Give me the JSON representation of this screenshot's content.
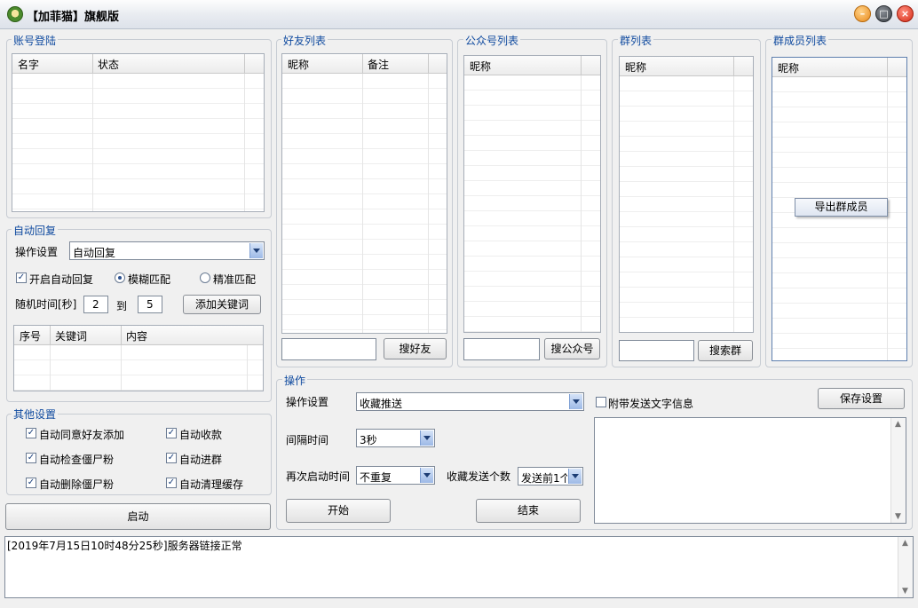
{
  "window": {
    "title": "【加菲猫】旗舰版",
    "controls": {
      "minimize": "minimize-icon",
      "maximize": "maximize-icon",
      "close": "close-icon"
    }
  },
  "account_login": {
    "legend": "账号登陆",
    "columns": [
      "名字",
      "状态"
    ]
  },
  "auto_reply": {
    "legend": "自动回复",
    "op_label": "操作设置",
    "op_value": "自动回复",
    "enable_label": "开启自动回复",
    "fuzzy_label": "模糊匹配",
    "exact_label": "精准匹配",
    "random_label": "随机时间[秒]",
    "random_from": "2",
    "to_label": "到",
    "random_to": "5",
    "add_keyword_button": "添加关键词",
    "columns": [
      "序号",
      "关键词",
      "内容"
    ]
  },
  "other_settings": {
    "legend": "其他设置",
    "items": [
      {
        "label": "自动同意好友添加",
        "checked": true
      },
      {
        "label": "自动收款",
        "checked": true
      },
      {
        "label": "自动检查僵尸粉",
        "checked": true
      },
      {
        "label": "自动进群",
        "checked": true
      },
      {
        "label": "自动删除僵尸粉",
        "checked": true
      },
      {
        "label": "自动清理缓存",
        "checked": true
      }
    ]
  },
  "start_button": "启动",
  "friend_list": {
    "legend": "好友列表",
    "columns": [
      "昵称",
      "备注"
    ],
    "search_button": "搜好友"
  },
  "official_list": {
    "legend": "公众号列表",
    "columns": [
      "昵称"
    ],
    "search_button": "搜公众号"
  },
  "group_list": {
    "legend": "群列表",
    "columns": [
      "昵称"
    ],
    "search_button": "搜索群"
  },
  "member_list": {
    "legend": "群成员列表",
    "columns": [
      "昵称"
    ],
    "export_button": "导出群成员"
  },
  "operation": {
    "legend": "操作",
    "op_label": "操作设置",
    "op_value": "收藏推送",
    "attach_text_label": "附带发送文字信息",
    "attach_text_checked": false,
    "save_button": "保存设置",
    "interval_label": "间隔时间",
    "interval_value": "3秒",
    "restart_label": "再次启动时间",
    "restart_value": "不重复",
    "fav_count_label": "收藏发送个数",
    "fav_count_value": "发送前1个",
    "start_button": "开始",
    "end_button": "结束"
  },
  "log": {
    "lines": [
      "[2019年7月15日10时48分25秒]服务器链接正常"
    ]
  }
}
